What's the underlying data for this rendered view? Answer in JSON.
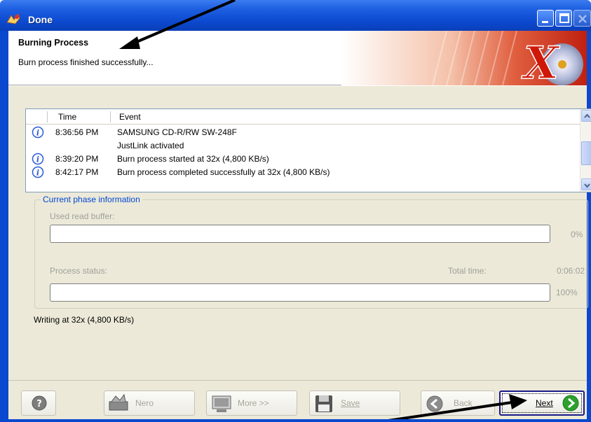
{
  "window": {
    "title": "Done"
  },
  "header": {
    "title": "Burning Process",
    "subtitle": "Burn process finished successfully..."
  },
  "log": {
    "columns": [
      "Time",
      "Event"
    ],
    "rows": [
      {
        "time": "8:36:56 PM",
        "event": "SAMSUNG CD-R/RW SW-248F",
        "icon": "info-icon"
      },
      {
        "time": "",
        "event": "JustLink activated",
        "icon": ""
      },
      {
        "time": "8:39:20 PM",
        "event": "Burn process started at 32x (4,800 KB/s)",
        "icon": "info-icon"
      },
      {
        "time": "8:42:17 PM",
        "event": "Burn process completed successfully at 32x (4,800 KB/s)",
        "icon": "info-icon"
      }
    ]
  },
  "phase": {
    "legend": "Current phase information",
    "read_buffer_label": "Used read buffer:",
    "read_buffer_percent": "0%",
    "read_buffer_fraction": 0,
    "status_label": "Process status:",
    "total_time_label": "Total time:",
    "total_time": "0:06:02",
    "status_percent": "100%",
    "status_fraction": 1.0
  },
  "writing_status": "Writing at 32x (4,800 KB/s)",
  "buttons": {
    "nero": "Nero",
    "more": "More >>",
    "save": "Save",
    "back": "Back",
    "next": "Next"
  },
  "colors": {
    "titlebar": "#0c49cf",
    "legend": "#0046d5",
    "info_icon": "#2a5bd7",
    "next_green": "#2da12d"
  }
}
